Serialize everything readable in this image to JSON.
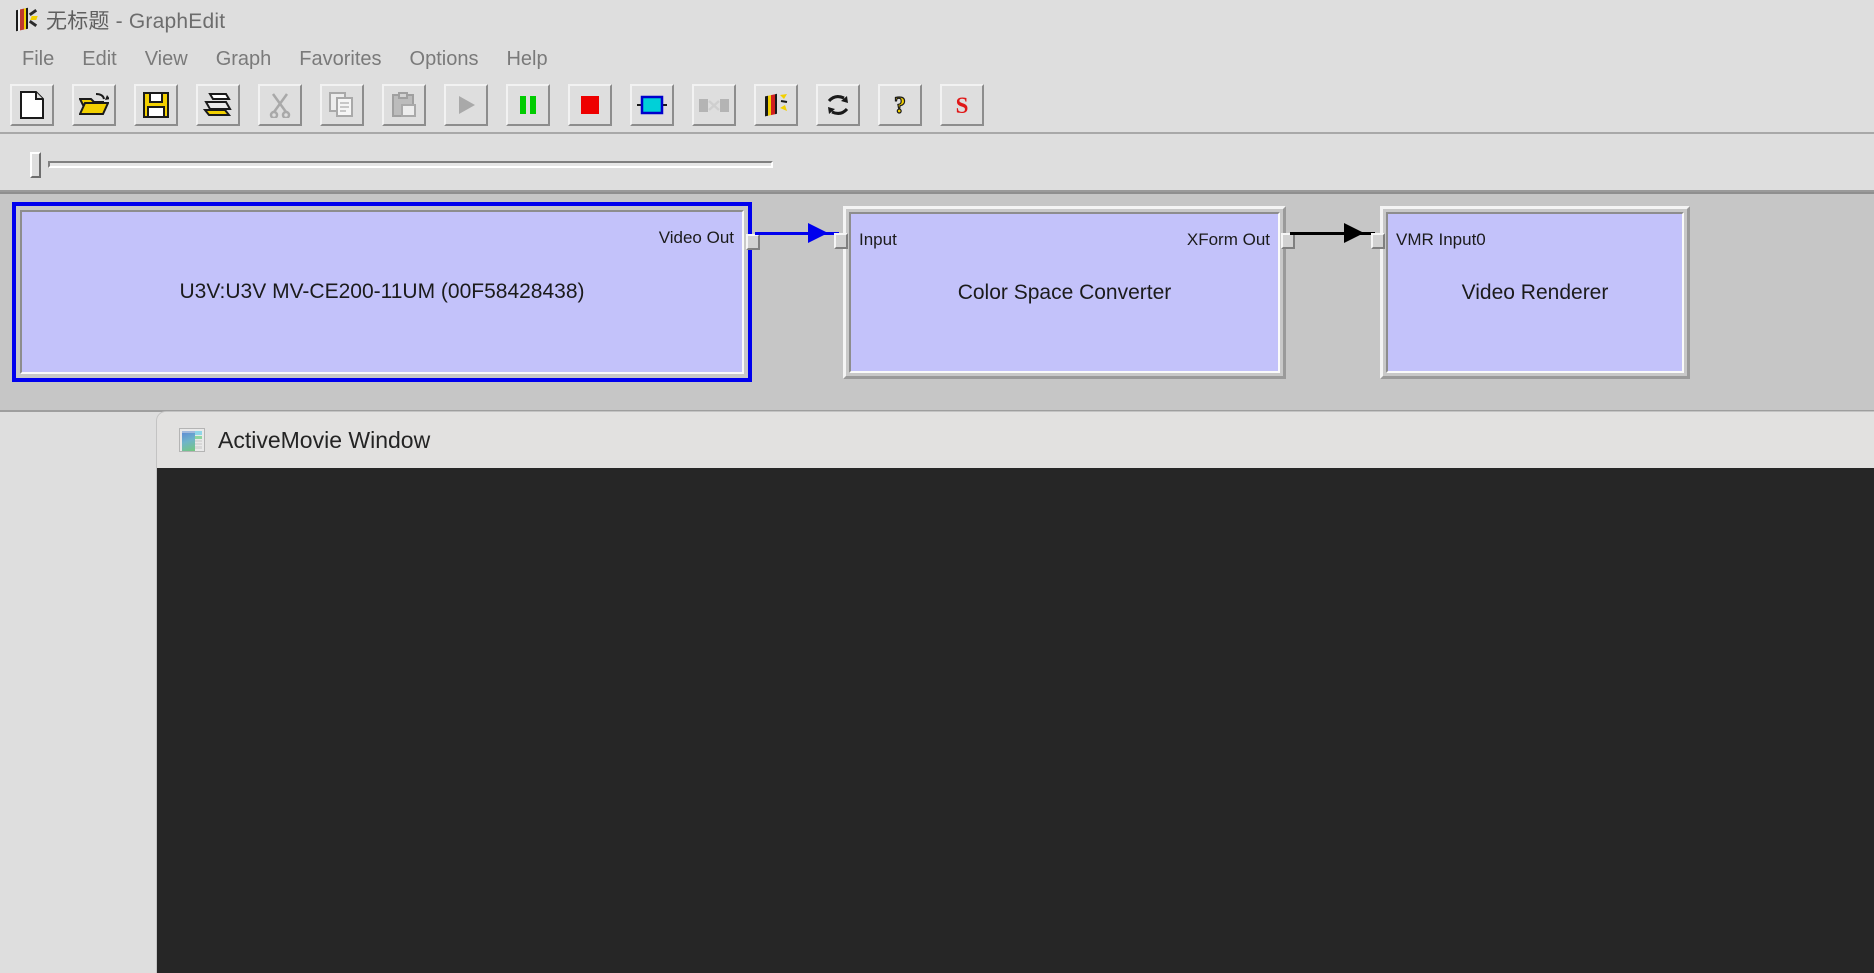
{
  "window": {
    "title_document": "无标题",
    "title_separator": " - ",
    "title_app": "GraphEdit",
    "app_icon": "graphedit-film-icon"
  },
  "menubar": {
    "items": [
      {
        "label": "File",
        "name": "menu-file"
      },
      {
        "label": "Edit",
        "name": "menu-edit"
      },
      {
        "label": "View",
        "name": "menu-view"
      },
      {
        "label": "Graph",
        "name": "menu-graph"
      },
      {
        "label": "Favorites",
        "name": "menu-favorites"
      },
      {
        "label": "Options",
        "name": "menu-options"
      },
      {
        "label": "Help",
        "name": "menu-help"
      }
    ]
  },
  "toolbar": {
    "buttons": [
      {
        "icon": "new-document-icon",
        "label": "New",
        "enabled": true
      },
      {
        "icon": "open-folder-icon",
        "label": "Open",
        "enabled": true
      },
      {
        "icon": "save-disk-icon",
        "label": "Save",
        "enabled": true
      },
      {
        "icon": "printer-icon",
        "label": "Print",
        "enabled": true
      },
      {
        "icon": "scissors-cut-icon",
        "label": "Cut",
        "enabled": false
      },
      {
        "icon": "copy-icon",
        "label": "Copy",
        "enabled": false
      },
      {
        "icon": "paste-clipboard-icon",
        "label": "Paste",
        "enabled": false
      },
      {
        "icon": "play-triangle-icon",
        "label": "Play",
        "enabled": false
      },
      {
        "icon": "pause-bars-icon",
        "label": "Pause",
        "enabled": true
      },
      {
        "icon": "stop-square-icon",
        "label": "Stop",
        "enabled": true
      },
      {
        "icon": "insert-filter-icon",
        "label": "Insert Filter",
        "enabled": true
      },
      {
        "icon": "disconnect-pin-icon",
        "label": "Disconnect",
        "enabled": false
      },
      {
        "icon": "graphedit-film-icon",
        "label": "Connect to Graph",
        "enabled": true
      },
      {
        "icon": "refresh-arrows-icon",
        "label": "Refresh",
        "enabled": true
      },
      {
        "icon": "help-question-icon",
        "label": "Help",
        "enabled": true
      },
      {
        "icon": "letter-s-icon",
        "label": "S",
        "enabled": true
      }
    ]
  },
  "trackbar": {
    "name": "seek-trackbar",
    "position": 0,
    "min": 0,
    "max": 100
  },
  "graph": {
    "filters": [
      {
        "id": "source",
        "name": "U3V:U3V MV-CE200-11UM (00F58428438)",
        "selected": true,
        "input_pins": [],
        "output_pins": [
          "Video Out"
        ]
      },
      {
        "id": "csc",
        "name": "Color Space Converter",
        "selected": false,
        "input_pins": [
          "Input"
        ],
        "output_pins": [
          "XForm Out"
        ]
      },
      {
        "id": "renderer",
        "name": "Video Renderer",
        "selected": false,
        "input_pins": [
          "VMR Input0"
        ],
        "output_pins": []
      }
    ],
    "connections": [
      {
        "from": "Video Out",
        "to": "Input",
        "color": "#0000ee"
      },
      {
        "from": "XForm Out",
        "to": "VMR Input0",
        "color": "#000000"
      }
    ],
    "colors": {
      "filter_body": "#c3c2fa",
      "selection": "#0000ee",
      "canvas": "#c6c6c6"
    }
  },
  "preview_window": {
    "title": "ActiveMovie Window",
    "icon": "media-preview-icon",
    "video_background": "#262626"
  }
}
